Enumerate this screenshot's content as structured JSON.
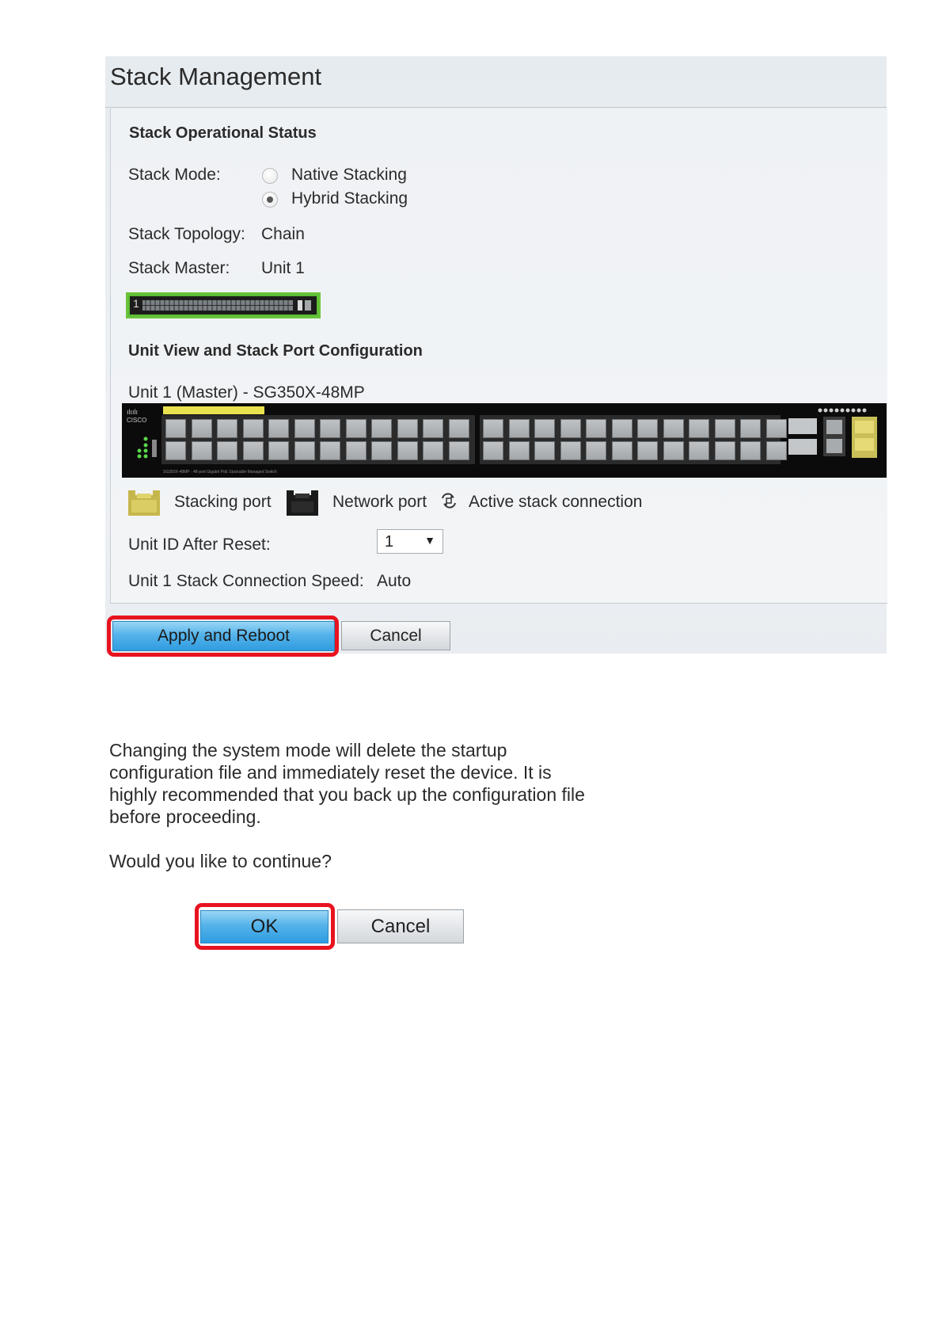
{
  "page_title": "Stack Management",
  "status_section": {
    "title": "Stack Operational Status",
    "stack_mode_label": "Stack Mode:",
    "options": [
      {
        "label": "Native Stacking",
        "selected": false
      },
      {
        "label": "Hybrid Stacking",
        "selected": true
      }
    ],
    "topology_label": "Stack Topology:",
    "topology_value": "Chain",
    "master_label": "Stack Master:",
    "master_value": "Unit 1",
    "mini_unit_number": "1"
  },
  "unit_view": {
    "title": "Unit View and Stack Port Configuration",
    "unit_caption": "Unit 1 (Master) - SG350X-48MP",
    "legend": {
      "stacking_port": "Stacking port",
      "network_port": "Network port",
      "active_connection": "Active stack connection"
    },
    "unit_id_after_reset_label": "Unit ID After Reset:",
    "unit_id_after_reset_value": "1",
    "speed_label": "Unit 1 Stack Connection Speed:",
    "speed_value": "Auto",
    "colors": {
      "stacking": "#e8d66a",
      "network": "#1a1a1a",
      "highlight": "#e8131f"
    }
  },
  "buttons": {
    "apply_reboot": "Apply and Reboot",
    "cancel": "Cancel"
  },
  "dialog": {
    "message_lines": [
      "Changing the system mode will delete the startup",
      "configuration file and immediately reset the device. It is",
      "highly recommended that you back up the configuration file",
      "before proceeding."
    ],
    "question": "Would you like to continue?",
    "ok": "OK",
    "cancel": "Cancel"
  }
}
